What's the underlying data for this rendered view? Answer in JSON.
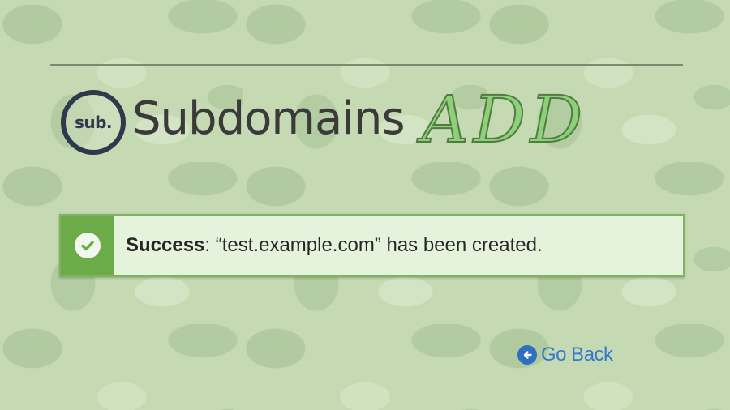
{
  "header": {
    "logo_text": "sub.",
    "title": "Subdomains",
    "title_accent": "ADD"
  },
  "alert": {
    "label": "Success",
    "separator": ": ",
    "message": "“test.example.com” has been created.",
    "icon": "check-circle-icon"
  },
  "actions": {
    "go_back_label": "Go Back",
    "go_back_icon": "arrow-left-circle-icon"
  },
  "colors": {
    "background": "#c5d9b3",
    "logo": "#2d3a4c",
    "accent": "#8fcf7a",
    "success": "#6bab48",
    "link": "#3378cf"
  }
}
